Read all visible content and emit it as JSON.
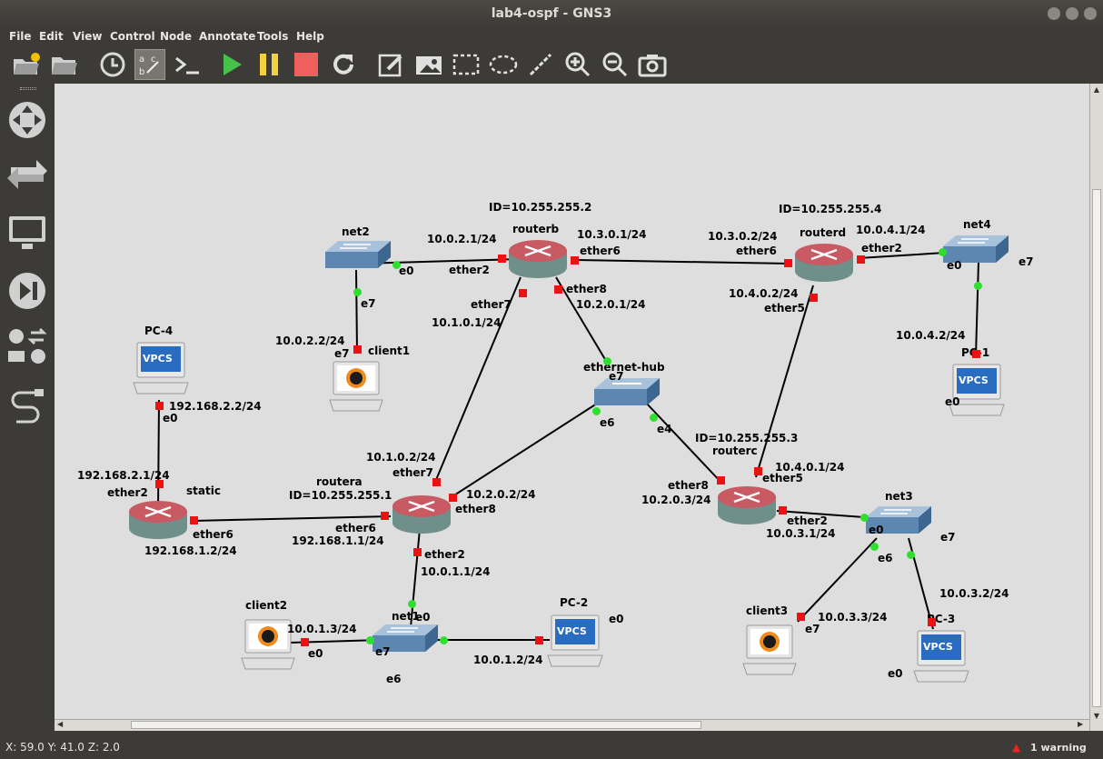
{
  "window": {
    "title": "lab4-ospf - GNS3"
  },
  "menu": [
    "File",
    "Edit",
    "View",
    "Control",
    "Node",
    "Annotate",
    "Tools",
    "Help"
  ],
  "toolbar_icons": [
    "open-project-icon",
    "open-folder-icon",
    "clock-icon",
    "snapshot-abc-icon",
    "console-icon",
    "start-icon",
    "pause-icon",
    "stop-icon",
    "reload-icon",
    "note-icon",
    "picture-icon",
    "rectangle-icon",
    "ellipse-icon",
    "line-icon",
    "zoom-in-icon",
    "zoom-out-icon",
    "screenshot-icon"
  ],
  "colors": {
    "link_up": "#2ee02e",
    "link_down": "#ee1111",
    "canvas": "#dedede",
    "router": "#c85a63"
  },
  "nodes": {
    "routerb": {
      "name": "routerb",
      "id": "ID=10.255.255.2"
    },
    "routerd": {
      "name": "routerd",
      "id": "ID=10.255.255.4"
    },
    "routera": {
      "name": "routera",
      "id": "ID=10.255.255.1"
    },
    "routerc": {
      "name": "routerc",
      "id": "ID=10.255.255.3"
    },
    "static": {
      "name": "static"
    },
    "net2": {
      "name": "net2"
    },
    "net4": {
      "name": "net4"
    },
    "net1": {
      "name": "net1"
    },
    "net3": {
      "name": "net3"
    },
    "hub": {
      "name": "ethernet-hub"
    },
    "pc4": {
      "name": "PC-4",
      "badge": "VPCS"
    },
    "pc1": {
      "name": "PC-1",
      "badge": "VPCS"
    },
    "pc2": {
      "name": "PC-2",
      "badge": "VPCS"
    },
    "pc3": {
      "name": "PC-3",
      "badge": "VPCS"
    },
    "client1": {
      "name": "client1"
    },
    "client2": {
      "name": "client2"
    },
    "client3": {
      "name": "client3"
    }
  },
  "labels": {
    "rb_ip_ether2": "10.0.2.1/24",
    "rb_ip_ether6": "10.3.0.1/24",
    "rb_ether6": "ether6",
    "rb_ether2": "ether2",
    "rb_ether7": "ether7",
    "rb_ether8": "ether8",
    "rb_ip_ether8": "10.2.0.1/24",
    "rb_ip_ether7": "10.1.0.1/24",
    "rd_ip_ether6": "10.3.0.2/24",
    "rd_ether6": "ether6",
    "rd_ip_ether2": "10.0.4.1/24",
    "rd_ether2": "ether2",
    "rd_ip_ether5": "10.4.0.2/24",
    "rd_ether5": "ether5",
    "net2_e0": "e0",
    "net2_e7": "e7",
    "c1_ip": "10.0.2.2/24",
    "c1_e7": "e7",
    "net4_e0": "e0",
    "net4_e7": "e7",
    "pc1_ip": "10.0.4.2/24",
    "pc1_e0": "e0",
    "hub_e7": "e7",
    "hub_e6": "e6",
    "hub_e4": "e4",
    "pc4_ip": "192.168.2.2/24",
    "pc4_e0": "e0",
    "st_ip_ether2": "192.168.2.1/24",
    "st_ether2": "ether2",
    "st_ether6": "ether6",
    "st_ip_ether6": "192.168.1.2/24",
    "ra_ip_ether7": "10.1.0.2/24",
    "ra_ether7": "ether7",
    "ra_ip_ether8": "10.2.0.2/24",
    "ra_ether8": "ether8",
    "ra_ether6": "ether6",
    "ra_ip_ether6": "192.168.1.1/24",
    "ra_ether2": "ether2",
    "ra_ip_ether2": "10.0.1.1/24",
    "rc_ether8": "ether8",
    "rc_ip_ether8": "10.2.0.3/24",
    "rc_ip_ether5": "10.4.0.1/24",
    "rc_ether5": "ether5",
    "rc_ether2": "ether2",
    "rc_ip_ether2": "10.0.3.1/24",
    "net3_e0": "e0",
    "net3_e6": "e6",
    "net3_e7": "e7",
    "pc3_ip": "10.0.3.2/24",
    "pc3_e0": "e0",
    "c3_ip": "10.0.3.3/24",
    "c3_e7": "e7",
    "c2_ip": "10.0.1.3/24",
    "c2_e0": "e0",
    "net1_e0": "e0",
    "net1_e7": "e7",
    "net1_e6": "e6",
    "pc2_e0": "e0",
    "pc2_ip": "10.0.1.2/24"
  },
  "status": {
    "coords": "X: 59.0 Y: 41.0 Z: 2.0",
    "warning": "1 warning"
  }
}
